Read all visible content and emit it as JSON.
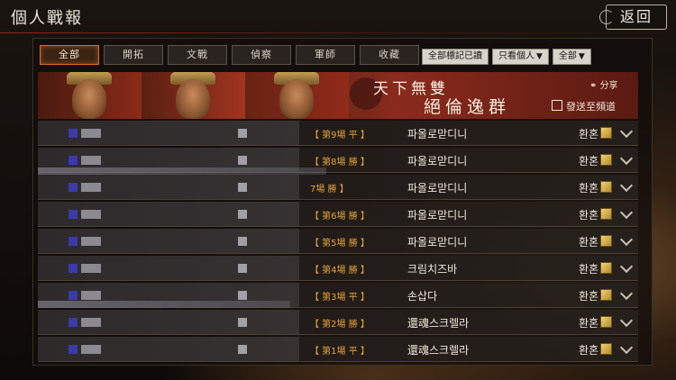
{
  "header": {
    "title": "個人戰報",
    "back_label": "返回"
  },
  "tabs": [
    "全部",
    "開拓",
    "文戰",
    "偵察",
    "軍師",
    "收藏"
  ],
  "filters": [
    {
      "label": "全部標記已讀",
      "dropdown": false
    },
    {
      "label": "只看個人",
      "dropdown": true
    },
    {
      "label": "全部",
      "dropdown": true
    }
  ],
  "banner": {
    "line1": "天下無雙",
    "line2": "絕倫逸群",
    "share_label": "分享",
    "send_label": "發送至頻道"
  },
  "records": [
    {
      "result": "【 第9場 平 】",
      "opponent": "파올로맏디니",
      "value": "환혼"
    },
    {
      "result": "【 第8場 勝 】",
      "opponent": "파올로맏디니",
      "value": "환혼"
    },
    {
      "result": "7場 勝 】",
      "opponent": "파올로맏디니",
      "value": "환혼"
    },
    {
      "result": "【 第6場 勝 】",
      "opponent": "파올로맏디니",
      "value": "환혼"
    },
    {
      "result": "【 第5場 勝 】",
      "opponent": "파올로맏디니",
      "value": "환혼"
    },
    {
      "result": "【 第4場 勝 】",
      "opponent": "크림치즈바",
      "value": "환혼"
    },
    {
      "result": "【 第3場 平 】",
      "opponent": "손삽다",
      "value": "환혼"
    },
    {
      "result": "【 第2場 勝 】",
      "opponent": "還魂스크렐라",
      "value": "환혼"
    },
    {
      "result": "【 第1場 平 】",
      "opponent": "還魂스크렐라",
      "value": "환혼"
    }
  ],
  "colors": {
    "active_tab": "#d86a28",
    "result_text": "#e6a23a",
    "banner_red": "#8a2a1c"
  }
}
